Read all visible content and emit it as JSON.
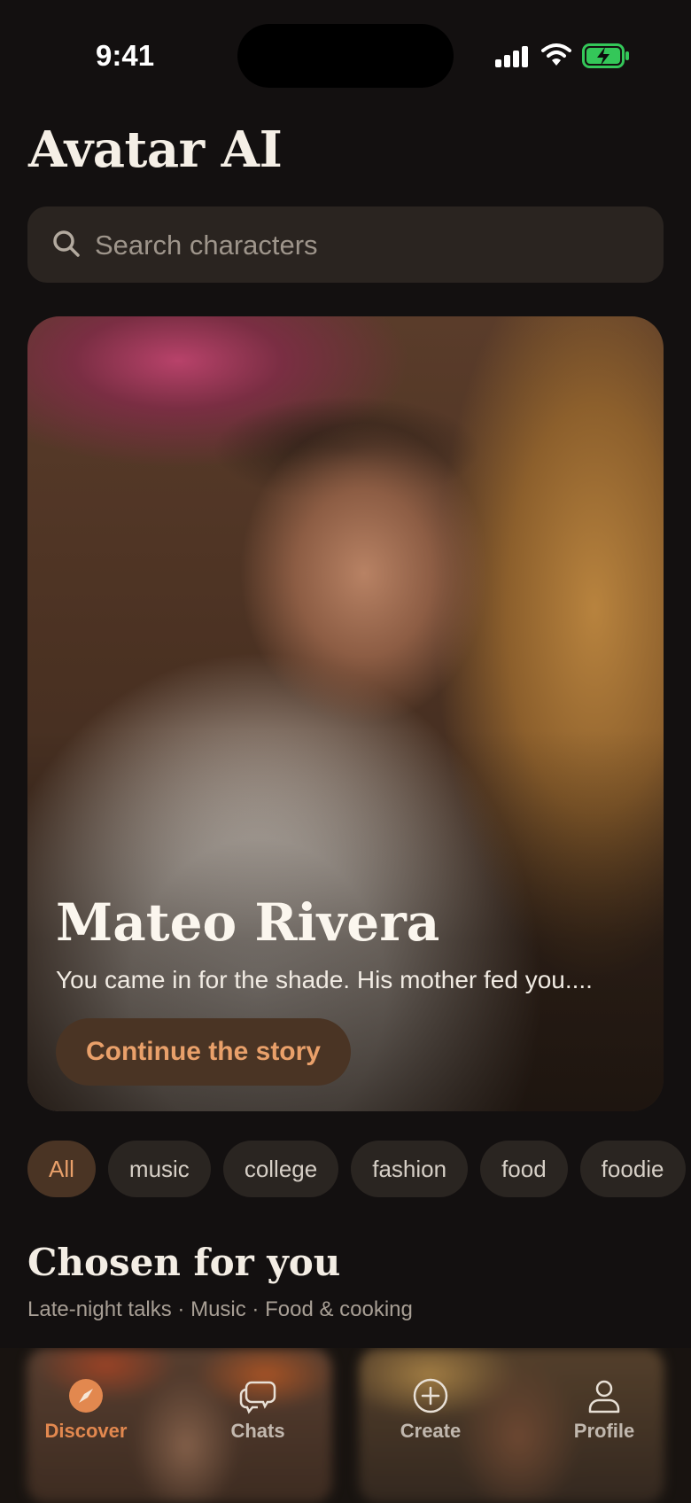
{
  "status_bar": {
    "time": "9:41"
  },
  "app": {
    "title": "Avatar AI"
  },
  "search": {
    "placeholder": "Search characters"
  },
  "hero": {
    "name": "Mateo Rivera",
    "description": "You came in for the shade. His mother fed you....",
    "cta_label": "Continue the story"
  },
  "categories": [
    "All",
    "music",
    "college",
    "fashion",
    "food",
    "foodie"
  ],
  "selected_category": "All",
  "section": {
    "title": "Chosen for you",
    "subtitle": "Late-night talks · Music · Food & cooking"
  },
  "tabs": [
    {
      "label": "Discover",
      "icon": "compass-icon",
      "active": true
    },
    {
      "label": "Chats",
      "icon": "chat-bubbles-icon",
      "active": false
    },
    {
      "label": "Create",
      "icon": "plus-circle-icon",
      "active": false
    },
    {
      "label": "Profile",
      "icon": "person-icon",
      "active": false
    }
  ],
  "colors": {
    "accent": "#e2884f",
    "background": "#131010",
    "chip_active_bg": "#4a3424"
  }
}
